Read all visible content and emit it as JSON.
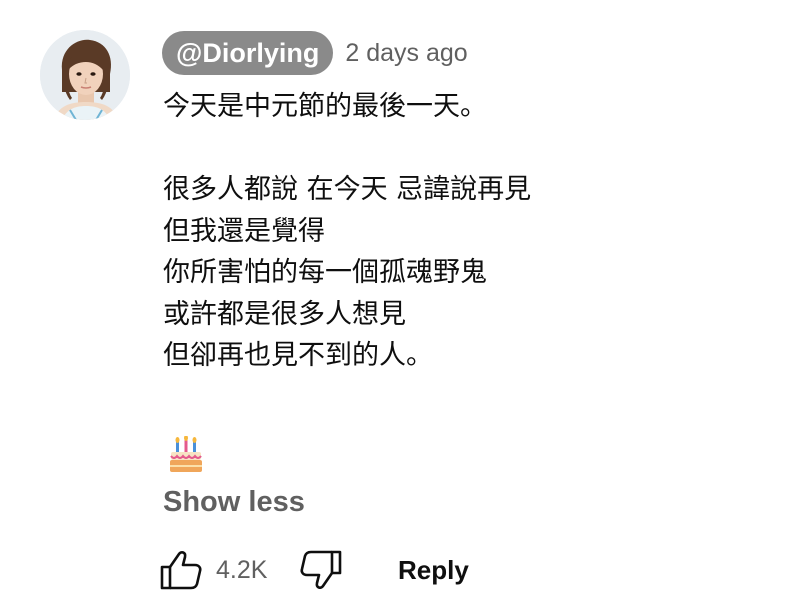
{
  "comment": {
    "author_handle": "@Diorlying",
    "timestamp": "2 days ago",
    "lines": [
      "今天是中元節的最後一天。",
      "",
      "很多人都說 在今天 忌諱說再見",
      "但我還是覺得",
      "你所害怕的每一個孤魂野鬼",
      "或許都是很多人想見",
      "但卻再也見不到的人。"
    ],
    "emoji": "birthday-cake"
  },
  "actions": {
    "show_less_label": "Show less",
    "like_count": "4.2K",
    "reply_label": "Reply"
  },
  "colors": {
    "handle_badge_bg": "#8a8a8a",
    "secondary_text": "#606060",
    "primary_text": "#0f0f0f"
  }
}
